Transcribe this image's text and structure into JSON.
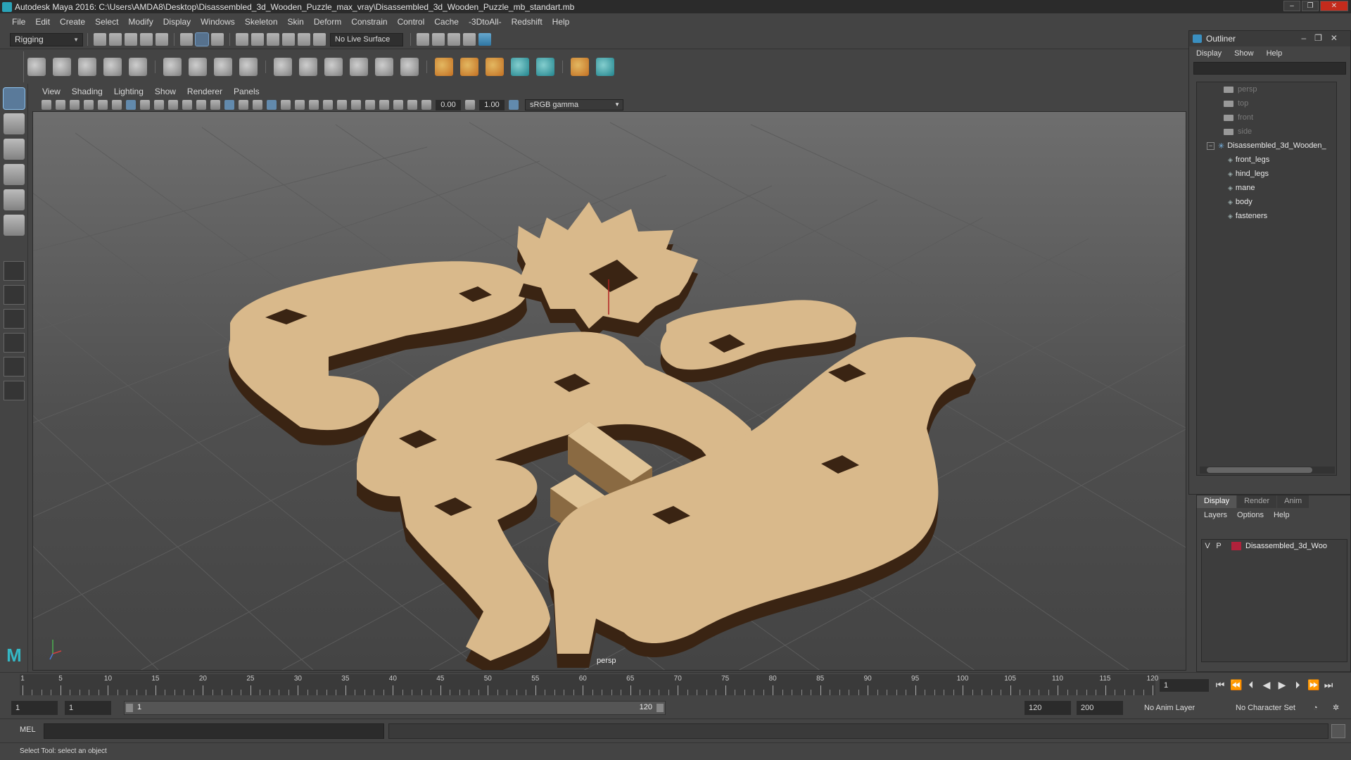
{
  "window": {
    "title": "Autodesk Maya 2016: C:\\Users\\AMDA8\\Desktop\\Disassembled_3d_Wooden_Puzzle_max_vray\\Disassembled_3d_Wooden_Puzzle_mb_standart.mb",
    "controls": [
      "–",
      "❐",
      "✕"
    ]
  },
  "menubar": [
    "File",
    "Edit",
    "Create",
    "Select",
    "Modify",
    "Display",
    "Windows",
    "Skeleton",
    "Skin",
    "Deform",
    "Constrain",
    "Control",
    "Cache",
    "-3DtoAll-",
    "Redshift",
    "Help"
  ],
  "statusline": {
    "mode": "Rigging",
    "live_surface": "No Live Surface"
  },
  "viewport": {
    "menu": [
      "View",
      "Shading",
      "Lighting",
      "Show",
      "Renderer",
      "Panels"
    ],
    "exposure": "0.00",
    "gamma": "1.00",
    "color_space": "sRGB gamma",
    "camera_label": "persp"
  },
  "outliner": {
    "title": "Outliner",
    "menu": [
      "Display",
      "Show",
      "Help"
    ],
    "items": [
      {
        "label": "persp",
        "kind": "camera"
      },
      {
        "label": "top",
        "kind": "camera"
      },
      {
        "label": "front",
        "kind": "camera"
      },
      {
        "label": "side",
        "kind": "camera"
      },
      {
        "label": "Disassembled_3d_Wooden_",
        "kind": "group"
      },
      {
        "label": "front_legs",
        "kind": "mesh"
      },
      {
        "label": "hind_legs",
        "kind": "mesh"
      },
      {
        "label": "mane",
        "kind": "mesh"
      },
      {
        "label": "body",
        "kind": "mesh"
      },
      {
        "label": "fasteners",
        "kind": "mesh"
      }
    ]
  },
  "layers": {
    "tabs": [
      "Display",
      "Render",
      "Anim"
    ],
    "menu": [
      "Layers",
      "Options",
      "Help"
    ],
    "rows": [
      {
        "v": "V",
        "p": "P",
        "name": "Disassembled_3d_Woo",
        "color": "#b0223b"
      }
    ]
  },
  "timeline": {
    "tick_labels": [
      "1",
      "5",
      "10",
      "15",
      "20",
      "25",
      "30",
      "35",
      "40",
      "45",
      "50",
      "55",
      "60",
      "65",
      "70",
      "75",
      "80",
      "85",
      "90",
      "95",
      "100",
      "105",
      "110",
      "115",
      "120"
    ],
    "current_frame": "1"
  },
  "range": {
    "start": "1",
    "playback_start": "1",
    "bar_start": "1",
    "bar_end": "120",
    "playback_end": "120",
    "end": "200",
    "anim_layer": "No Anim Layer",
    "character_set": "No Character Set"
  },
  "command": {
    "label": "MEL"
  },
  "help_line": "Select Tool: select an object",
  "colors": {
    "wood": "#d9b98b",
    "wood_edge": "#3a2413",
    "accent": "#2aa3b8",
    "layer": "#b0223b"
  }
}
